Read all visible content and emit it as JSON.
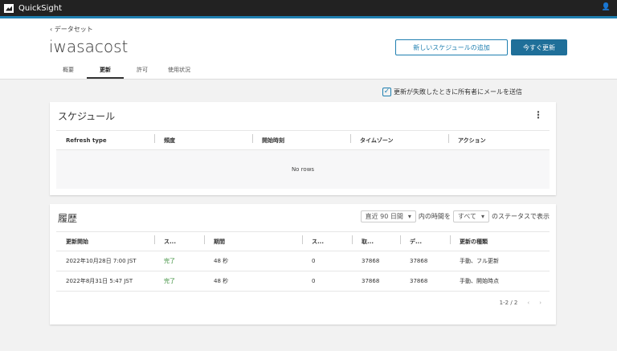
{
  "app": {
    "name": "QuickSight"
  },
  "header": {
    "back_label": "データセット",
    "title": "iwasacost",
    "tabs": [
      "概要",
      "更新",
      "許可",
      "使用状況"
    ],
    "active_tab": 1,
    "add_schedule": "新しいスケジュールの追加",
    "refresh_now": "今すぐ更新"
  },
  "notify": {
    "label": "更新が失敗したときに所有者にメールを送信",
    "checked": true
  },
  "schedule": {
    "title": "スケジュール",
    "columns": [
      "Refresh type",
      "頻度",
      "開始時刻",
      "タイムゾーン",
      "アクション"
    ],
    "empty": "No rows"
  },
  "history": {
    "title": "履歴",
    "filter": {
      "period": "直近 90 日間",
      "mid": "内の時間を",
      "status": "すべて",
      "suffix": "のステータスで表示"
    },
    "columns": [
      "更新開始",
      "ス...",
      "期間",
      "ス...",
      "取...",
      "デ...",
      "更新の種類"
    ],
    "rows": [
      [
        "2022年10月28日 7:00 JST",
        "完了",
        "48 秒",
        "0",
        "37868",
        "37868",
        "手動、フル更新"
      ],
      [
        "2022年8月31日 5:47 JST",
        "完了",
        "48 秒",
        "0",
        "37868",
        "37868",
        "手動、開始時点"
      ]
    ],
    "pagination": "1-2 / 2"
  }
}
